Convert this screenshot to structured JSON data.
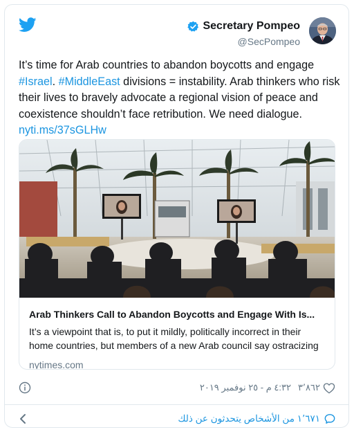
{
  "author": {
    "display_name": "Secretary Pompeo",
    "handle": "@SecPompeo",
    "verified": true
  },
  "tweet": {
    "text_intro": "It’s time for Arab countries to abandon boycotts and engage ",
    "hashtag_1": "#Israel",
    "text_sep": ". ",
    "hashtag_2": "#MiddleEast",
    "text_rest": " divisions = instability. Arab thinkers who risk their lives to bravely advocate a regional vision of peace and coexistence shouldn’t face retribution. We need dialogue. ",
    "link": "nyti.ms/37sGLHw"
  },
  "card": {
    "title": "Arab Thinkers Call to Abandon Boycotts and Engage With Is...",
    "description": "It’s a viewpoint that is, to put it mildly, politically incorrect in their home countries, but members of a new Arab council say ostracizing",
    "domain": "nytimes.com"
  },
  "meta": {
    "timestamp": "٤:٣٢ م - ٢٥ نوفمبر ٢٠١٩",
    "likes": "٣٬٨٦٢"
  },
  "footer": {
    "conversation_text": "١٬٦٧١ من الأشخاص يتحدثون عن ذلك"
  },
  "colors": {
    "link": "#1b95e0",
    "verified": "#1da1f2",
    "muted": "#657786",
    "border": "#e1e8ed"
  },
  "icons": [
    "twitter-bird-icon",
    "verified-badge-icon",
    "info-icon",
    "heart-icon",
    "chevron-left-icon",
    "speech-bubble-icon"
  ]
}
